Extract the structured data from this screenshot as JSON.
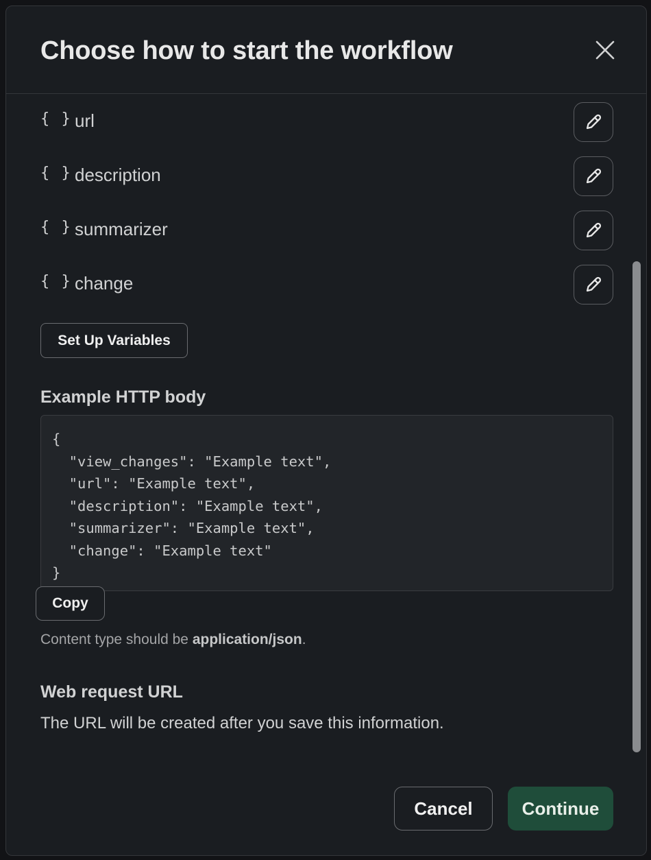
{
  "dialog": {
    "title": "Choose how to start the workflow",
    "close_icon": "close-icon"
  },
  "variables": [
    {
      "braces": "{ }",
      "name": "url",
      "edit_icon": "pencil-icon"
    },
    {
      "braces": "{ }",
      "name": "description",
      "edit_icon": "pencil-icon"
    },
    {
      "braces": "{ }",
      "name": "summarizer",
      "edit_icon": "pencil-icon"
    },
    {
      "braces": "{ }",
      "name": "change",
      "edit_icon": "pencil-icon"
    }
  ],
  "setup_button": "Set Up Variables",
  "example": {
    "heading": "Example HTTP body",
    "code": "{\n  \"view_changes\": \"Example text\",\n  \"url\": \"Example text\",\n  \"description\": \"Example text\",\n  \"summarizer\": \"Example text\",\n  \"change\": \"Example text\"\n}",
    "copy_button": "Copy",
    "hint_prefix": "Content type should be ",
    "hint_bold": "application/json",
    "hint_suffix": "."
  },
  "web_request": {
    "heading": "Web request URL",
    "text": "The URL will be created after you save this information."
  },
  "footer": {
    "cancel_label": "Cancel",
    "continue_label": "Continue"
  },
  "colors": {
    "background": "#1a1d21",
    "primary_button": "#1f4d3a",
    "border": "#34363a"
  }
}
